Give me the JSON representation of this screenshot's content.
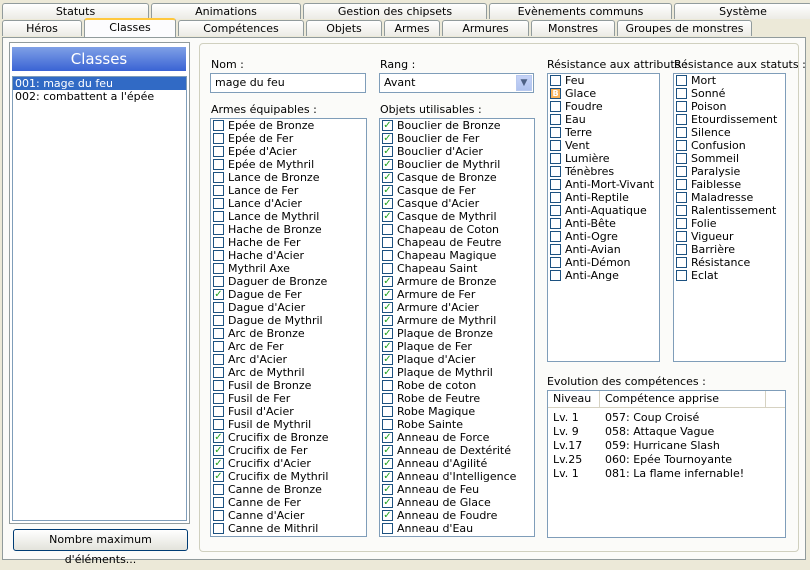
{
  "tabs_row1": [
    "Statuts",
    "Animations",
    "Gestion des chipsets",
    "Evènements communs",
    "Système"
  ],
  "tabs_row2": [
    "Héros",
    "Classes",
    "Compétences",
    "Objets",
    "Armes",
    "Armures",
    "Monstres",
    "Groupes de monstres"
  ],
  "active_tab": "Classes",
  "left": {
    "header": "Classes",
    "items": [
      "001: mage du feu",
      "002: combattent a l'épée"
    ],
    "selected_index": 0,
    "max_button": "Nombre maximum d'éléments..."
  },
  "form": {
    "nom_label": "Nom :",
    "nom_value": "mage du feu",
    "rang_label": "Rang :",
    "rang_value": "Avant",
    "armes_label": "Armes équipables :",
    "objets_label": "Objets utilisables :",
    "res_attr_label": "Résistance aux attributs :",
    "res_stat_label": "Résistance aux statuts :",
    "evo_label": "Evolution des compétences :",
    "evo_col_niveau": "Niveau",
    "evo_col_comp": "Compétence apprise"
  },
  "armes": [
    {
      "label": "Epée de Bronze",
      "checked": false
    },
    {
      "label": "Epée de Fer",
      "checked": false
    },
    {
      "label": "Epée d'Acier",
      "checked": false
    },
    {
      "label": "Epée de Mythril",
      "checked": false
    },
    {
      "label": "Lance de Bronze",
      "checked": false
    },
    {
      "label": "Lance de Fer",
      "checked": false
    },
    {
      "label": "Lance d'Acier",
      "checked": false
    },
    {
      "label": "Lance de Mythril",
      "checked": false
    },
    {
      "label": "Hache de Bronze",
      "checked": false
    },
    {
      "label": "Hache de Fer",
      "checked": false
    },
    {
      "label": "Hache d'Acier",
      "checked": false
    },
    {
      "label": "Mythril Axe",
      "checked": false
    },
    {
      "label": "Daguer de Bronze",
      "checked": false
    },
    {
      "label": "Dague de Fer",
      "checked": true
    },
    {
      "label": "Dague d'Acier",
      "checked": false
    },
    {
      "label": "Dague de Mythril",
      "checked": false
    },
    {
      "label": "Arc de Bronze",
      "checked": false
    },
    {
      "label": "Arc de Fer",
      "checked": false
    },
    {
      "label": "Arc d'Acier",
      "checked": false
    },
    {
      "label": "Arc de Mythril",
      "checked": false
    },
    {
      "label": "Fusil de Bronze",
      "checked": false
    },
    {
      "label": "Fusil de Fer",
      "checked": false
    },
    {
      "label": "Fusil d'Acier",
      "checked": false
    },
    {
      "label": "Fusil de Mythril",
      "checked": false
    },
    {
      "label": "Crucifix de Bronze",
      "checked": true
    },
    {
      "label": "Crucifix de Fer",
      "checked": true
    },
    {
      "label": "Crucifix d'Acier",
      "checked": true
    },
    {
      "label": "Crucifix de Mythril",
      "checked": true
    },
    {
      "label": "Canne de Bronze",
      "checked": false
    },
    {
      "label": "Canne de Fer",
      "checked": false
    },
    {
      "label": "Canne d'Acier",
      "checked": false
    },
    {
      "label": "Canne de Mithril",
      "checked": false
    }
  ],
  "objets": [
    {
      "label": "Bouclier de Bronze",
      "checked": true
    },
    {
      "label": "Bouclier de Fer",
      "checked": true
    },
    {
      "label": "Bouclier d'Acier",
      "checked": true
    },
    {
      "label": "Bouclier de Mythril",
      "checked": true
    },
    {
      "label": "Casque de Bronze",
      "checked": true
    },
    {
      "label": "Casque de Fer",
      "checked": true
    },
    {
      "label": "Casque d'Acier",
      "checked": true
    },
    {
      "label": "Casque de Mythril",
      "checked": true
    },
    {
      "label": "Chapeau de Coton",
      "checked": false
    },
    {
      "label": "Chapeau de Feutre",
      "checked": false
    },
    {
      "label": "Chapeau Magique",
      "checked": false
    },
    {
      "label": "Chapeau Saint",
      "checked": false
    },
    {
      "label": "Armure de Bronze",
      "checked": true
    },
    {
      "label": "Armure de Fer",
      "checked": true
    },
    {
      "label": "Armure d'Acier",
      "checked": true
    },
    {
      "label": "Armure de Mythril",
      "checked": true
    },
    {
      "label": "Plaque de Bronze",
      "checked": true
    },
    {
      "label": "Plaque de Fer",
      "checked": true
    },
    {
      "label": "Plaque d'Acier",
      "checked": true
    },
    {
      "label": "Plaque de Mythril",
      "checked": true
    },
    {
      "label": "Robe de coton",
      "checked": false
    },
    {
      "label": "Robe de Feutre",
      "checked": false
    },
    {
      "label": "Robe Magique",
      "checked": false
    },
    {
      "label": "Robe Sainte",
      "checked": false
    },
    {
      "label": "Anneau de Force",
      "checked": true
    },
    {
      "label": "Anneau de Dextérité",
      "checked": true
    },
    {
      "label": "Anneau d'Agilité",
      "checked": true
    },
    {
      "label": "Anneau d'Intelligence",
      "checked": true
    },
    {
      "label": "Anneau de Feu",
      "checked": true
    },
    {
      "label": "Anneau de Glace",
      "checked": true
    },
    {
      "label": "Anneau de Foudre",
      "checked": true
    },
    {
      "label": "Anneau d'Eau",
      "checked": false
    }
  ],
  "res_attributs": [
    {
      "label": "Feu",
      "mark": ""
    },
    {
      "label": "Glace",
      "mark": "B"
    },
    {
      "label": "Foudre",
      "mark": ""
    },
    {
      "label": "Eau",
      "mark": ""
    },
    {
      "label": "Terre",
      "mark": ""
    },
    {
      "label": "Vent",
      "mark": ""
    },
    {
      "label": "Lumière",
      "mark": ""
    },
    {
      "label": "Ténèbres",
      "mark": ""
    },
    {
      "label": "Anti-Mort-Vivant",
      "mark": ""
    },
    {
      "label": "Anti-Reptile",
      "mark": ""
    },
    {
      "label": "Anti-Aquatique",
      "mark": ""
    },
    {
      "label": "Anti-Bête",
      "mark": ""
    },
    {
      "label": "Anti-Ogre",
      "mark": ""
    },
    {
      "label": "Anti-Avian",
      "mark": ""
    },
    {
      "label": "Anti-Démon",
      "mark": ""
    },
    {
      "label": "Anti-Ange",
      "mark": ""
    }
  ],
  "res_statuts": [
    "Mort",
    "Sonné",
    "Poison",
    "Etourdissement",
    "Silence",
    "Confusion",
    "Sommeil",
    "Paralysie",
    "Faiblesse",
    "Maladresse",
    "Ralentissement",
    "Folie",
    "Vigueur",
    "Barrière",
    "Résistance",
    "Eclat"
  ],
  "evolution": [
    {
      "level": "Lv. 1",
      "skill": "057: Coup Croisé"
    },
    {
      "level": "Lv. 9",
      "skill": "058: Attaque Vague"
    },
    {
      "level": "Lv.17",
      "skill": "059: Hurricane Slash"
    },
    {
      "level": "Lv.25",
      "skill": "060: Epée Tournoyante"
    },
    {
      "level": "Lv. 1",
      "skill": "081: La flame infernable!"
    }
  ]
}
